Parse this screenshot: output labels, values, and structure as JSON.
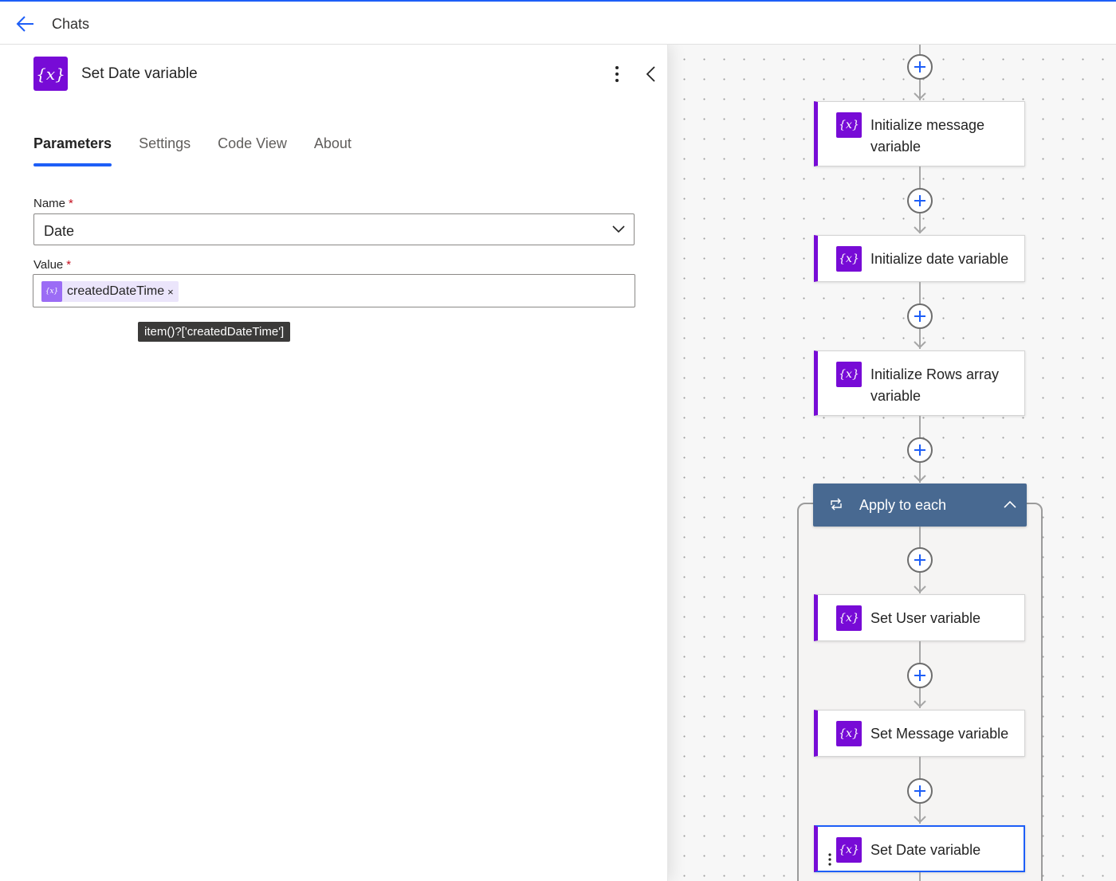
{
  "topbar": {
    "title": "Chats"
  },
  "panel": {
    "title": "Set Date variable",
    "icon": "variable-icon",
    "tabs": [
      {
        "label": "Parameters",
        "active": true
      },
      {
        "label": "Settings",
        "active": false
      },
      {
        "label": "Code View",
        "active": false
      },
      {
        "label": "About",
        "active": false
      }
    ],
    "name_field": {
      "label": "Name",
      "required_mark": "*",
      "value": "Date"
    },
    "value_field": {
      "label": "Value",
      "required_mark": "*",
      "token_label": "createdDateTime",
      "token_remove": "×",
      "tooltip": "item()?['createdDateTime']"
    }
  },
  "canvas": {
    "cards": [
      {
        "title": "Initialize message variable"
      },
      {
        "title": "Initialize date variable"
      },
      {
        "title": "Initialize Rows array variable"
      }
    ],
    "loop": {
      "title": "Apply to each",
      "cards": [
        {
          "title": "Set User variable"
        },
        {
          "title": "Set Message variable"
        },
        {
          "title": "Set Date variable",
          "selected": true
        }
      ]
    }
  },
  "colors": {
    "accent": "#1d5ef7",
    "variable": "#770bd6",
    "loop_header": "#486991"
  }
}
